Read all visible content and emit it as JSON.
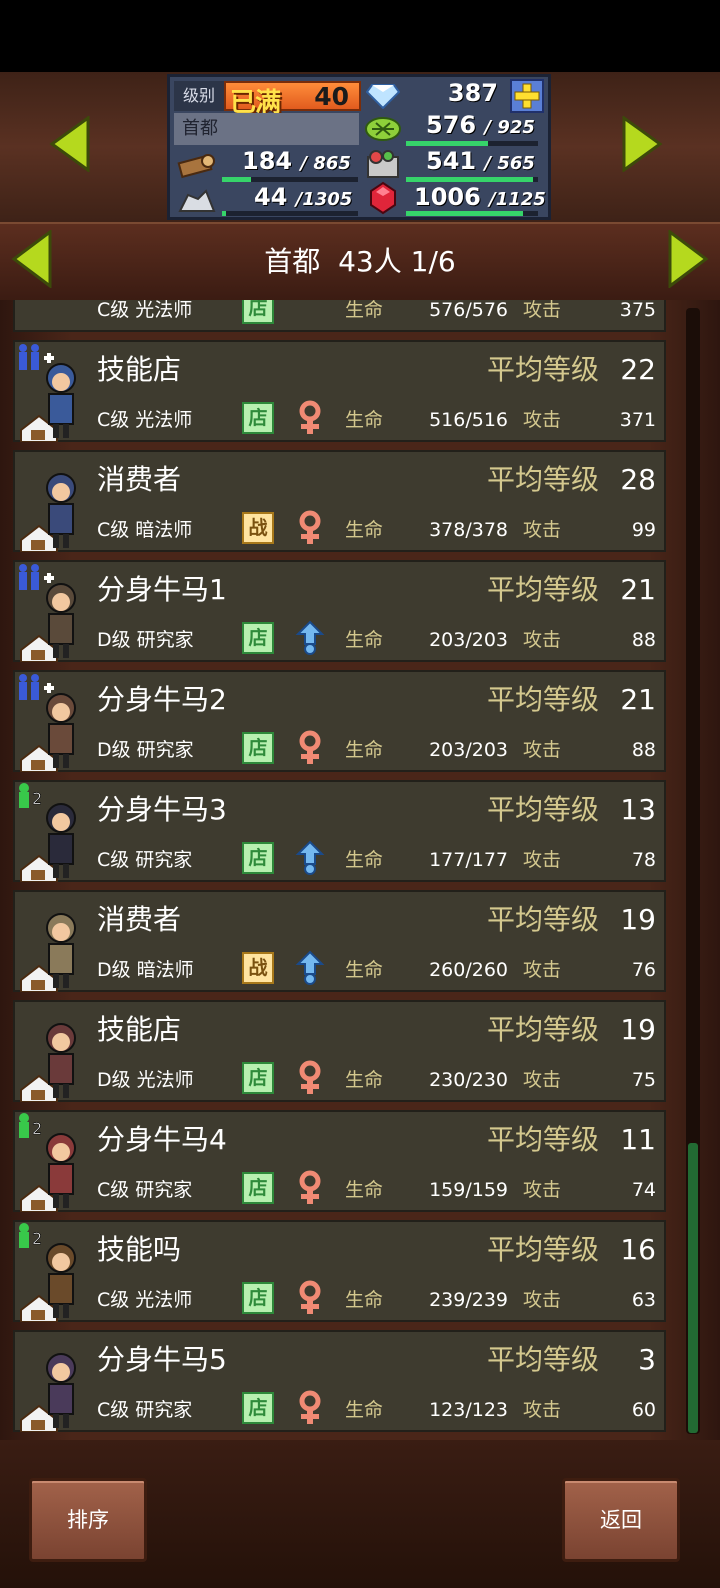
{
  "header": {
    "level_label": "级别",
    "level_max": "已满",
    "level": "40",
    "gems": "387",
    "city": "首都",
    "resources": [
      {
        "icon": "grass-icon",
        "value": "576",
        "max": "925",
        "fill": 0.62
      },
      {
        "icon": "wood-icon",
        "value": "184",
        "max": "865",
        "fill": 0.21
      },
      {
        "icon": "food-icon",
        "value": "541",
        "max": "565",
        "fill": 0.96
      },
      {
        "icon": "ore-icon",
        "value": "44",
        "max": "1305",
        "fill": 0.03
      },
      {
        "icon": "ruby-icon",
        "value": "1006",
        "max": "1125",
        "fill": 0.89
      }
    ]
  },
  "title": {
    "city": "首都",
    "count": "43人",
    "page": "1/6"
  },
  "labels": {
    "avg_level": "平均等级",
    "hp": "生命",
    "atk": "攻击"
  },
  "partial_row": {
    "rank_job": "C级 光法师",
    "role": "店",
    "hp": "576/576",
    "atk": "375"
  },
  "units": [
    {
      "name": "技能店",
      "rank_job": "C级 光法师",
      "role": "店",
      "role_type": "shop",
      "gender": "female",
      "level": "22",
      "hp": "516/516",
      "atk": "371",
      "party": "group"
    },
    {
      "name": "消费者",
      "rank_job": "C级 暗法师",
      "role": "战",
      "role_type": "battle",
      "gender": "female",
      "level": "28",
      "hp": "378/378",
      "atk": "99",
      "party": ""
    },
    {
      "name": "分身牛马1",
      "rank_job": "D级 研究家",
      "role": "店",
      "role_type": "shop",
      "gender": "male",
      "level": "21",
      "hp": "203/203",
      "atk": "88",
      "party": "group"
    },
    {
      "name": "分身牛马2",
      "rank_job": "D级 研究家",
      "role": "店",
      "role_type": "shop",
      "gender": "female",
      "level": "21",
      "hp": "203/203",
      "atk": "88",
      "party": "group"
    },
    {
      "name": "分身牛马3",
      "rank_job": "C级 研究家",
      "role": "店",
      "role_type": "shop",
      "gender": "male",
      "level": "13",
      "hp": "177/177",
      "atk": "78",
      "party": "2"
    },
    {
      "name": "消费者",
      "rank_job": "D级 暗法师",
      "role": "战",
      "role_type": "battle",
      "gender": "male",
      "level": "19",
      "hp": "260/260",
      "atk": "76",
      "party": ""
    },
    {
      "name": "技能店",
      "rank_job": "D级 光法师",
      "role": "店",
      "role_type": "shop",
      "gender": "female",
      "level": "19",
      "hp": "230/230",
      "atk": "75",
      "party": ""
    },
    {
      "name": "分身牛马4",
      "rank_job": "C级 研究家",
      "role": "店",
      "role_type": "shop",
      "gender": "female",
      "level": "11",
      "hp": "159/159",
      "atk": "74",
      "party": "2"
    },
    {
      "name": "技能吗",
      "rank_job": "C级 光法师",
      "role": "店",
      "role_type": "shop",
      "gender": "female",
      "level": "16",
      "hp": "239/239",
      "atk": "63",
      "party": "2"
    },
    {
      "name": "分身牛马5",
      "rank_job": "C级 研究家",
      "role": "店",
      "role_type": "shop",
      "gender": "female",
      "level": "3",
      "hp": "123/123",
      "atk": "60",
      "party": ""
    }
  ],
  "buttons": {
    "sort": "排序",
    "back": "返回"
  },
  "colors": {
    "accent_gold": "#d4c88e",
    "bar_green": "#36d46a",
    "row_bg": "#3e3b2f",
    "wood_bg": "#4a2619"
  }
}
